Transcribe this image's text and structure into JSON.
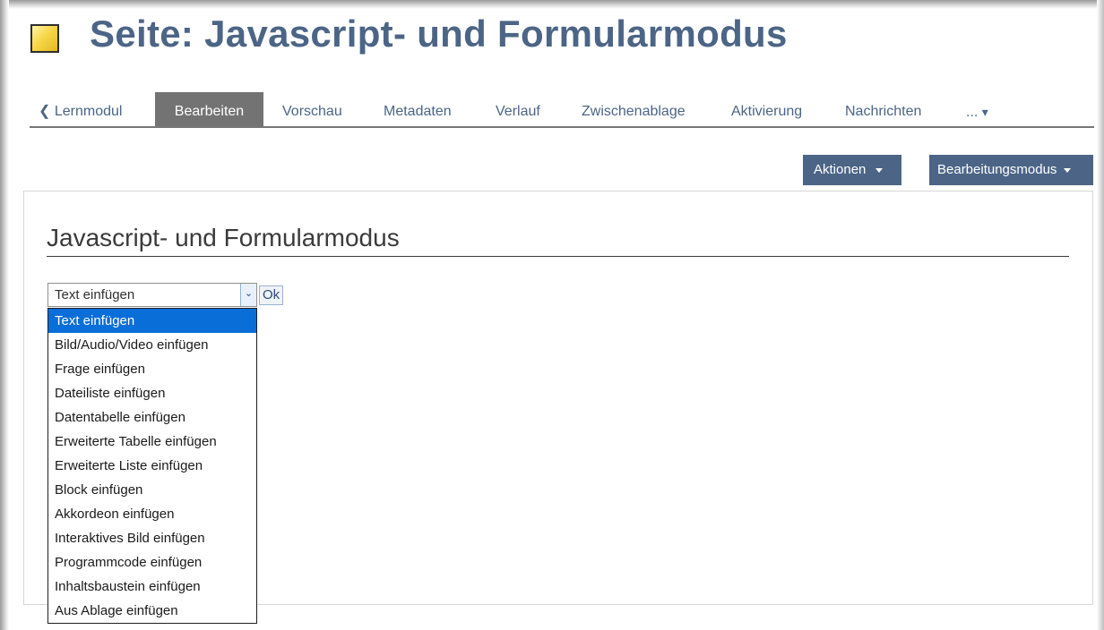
{
  "header": {
    "title": "Seite: Javascript- und Formularmodus"
  },
  "tabs": [
    {
      "label": "Lernmodul",
      "icon": "chevron-left-icon"
    },
    {
      "label": "Bearbeiten",
      "active": true
    },
    {
      "label": "Vorschau"
    },
    {
      "label": "Metadaten"
    },
    {
      "label": "Verlauf"
    },
    {
      "label": "Zwischenablage"
    },
    {
      "label": "Aktivierung"
    },
    {
      "label": "Nachrichten"
    },
    {
      "label": "..."
    }
  ],
  "toolbar": {
    "actions_label": "Aktionen",
    "mode_label": "Bearbeitungsmodus"
  },
  "content": {
    "heading": "Javascript- und Formularmodus"
  },
  "insert_select": {
    "value": "Text einfügen",
    "ok_label": "Ok",
    "options": [
      "Text einfügen",
      "Bild/Audio/Video einfügen",
      "Frage einfügen",
      "Dateiliste einfügen",
      "Datentabelle einfügen",
      "Erweiterte Tabelle einfügen",
      "Erweiterte Liste einfügen",
      "Block einfügen",
      "Akkordeon einfügen",
      "Interaktives Bild einfügen",
      "Programmcode einfügen",
      "Inhaltsbaustein einfügen",
      "Aus Ablage einfügen"
    ],
    "selected_index": 0
  },
  "colors": {
    "brand": "#4c6586",
    "active_tab": "#737373",
    "selection": "#0a6ed8"
  }
}
